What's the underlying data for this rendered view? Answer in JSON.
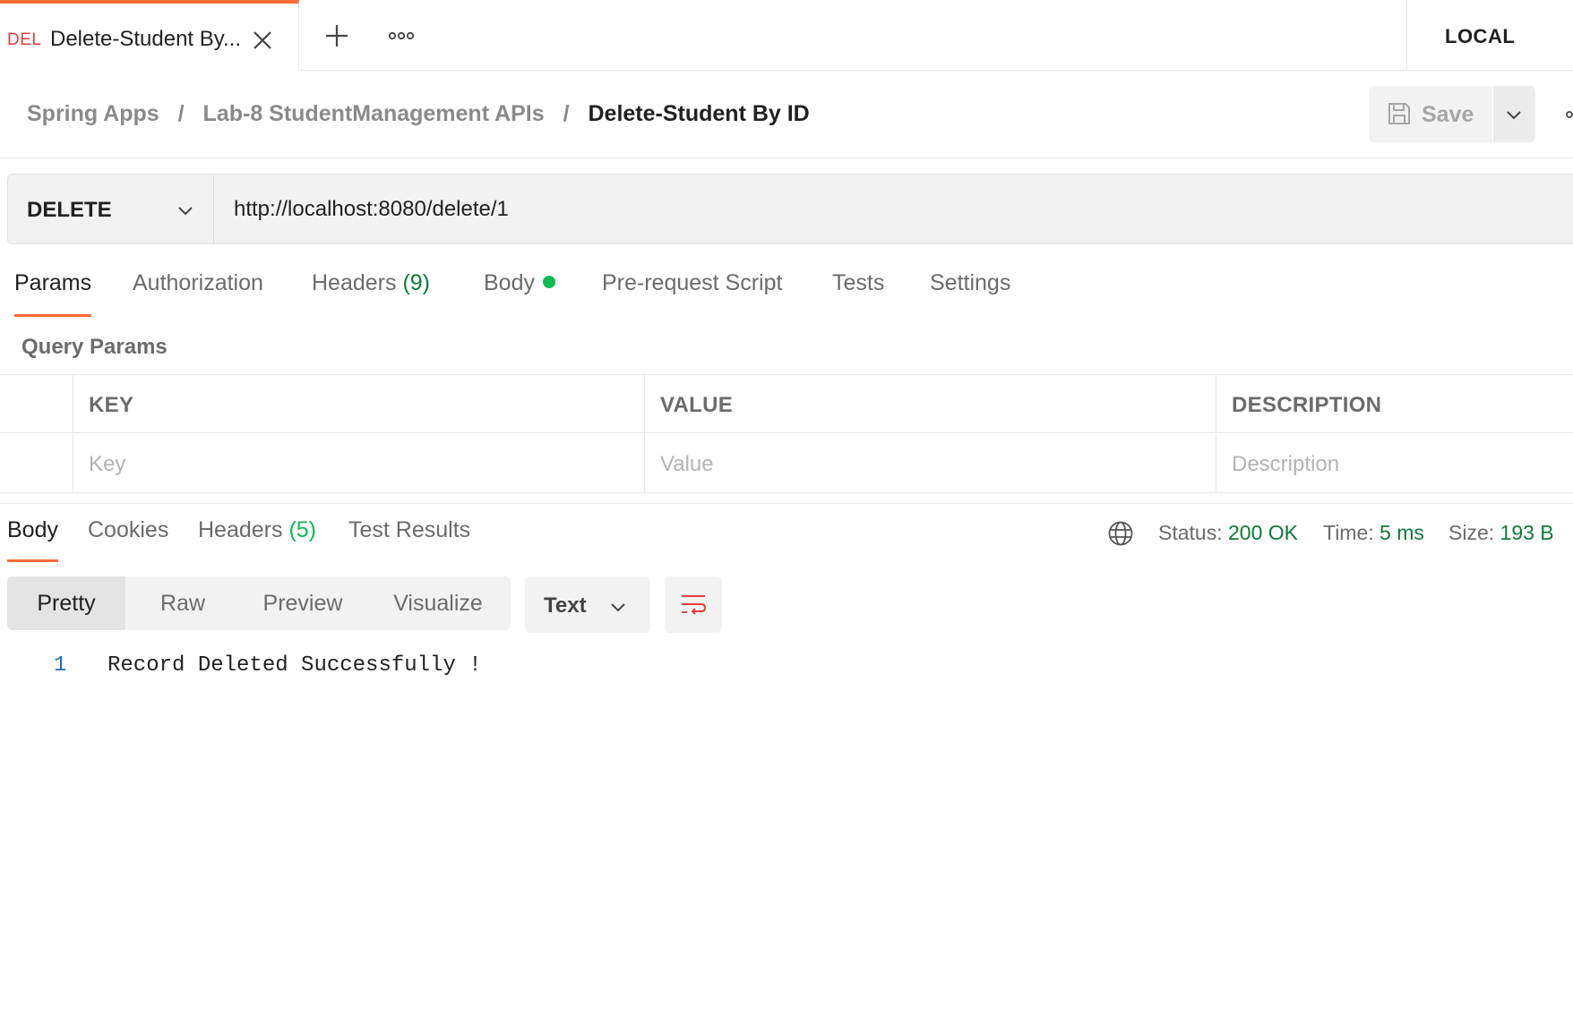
{
  "tabs": {
    "active": {
      "method": "DEL",
      "title": "Delete-Student By..."
    },
    "environment": "LOCAL"
  },
  "breadcrumb": {
    "items": [
      "Spring Apps",
      "Lab-8 StudentManagement APIs"
    ],
    "separator": "/",
    "current": "Delete-Student By ID"
  },
  "toolbar": {
    "save_label": "Save"
  },
  "request": {
    "method": "DELETE",
    "url": "http://localhost:8080/delete/1"
  },
  "request_tabs": {
    "params": "Params",
    "authorization": "Authorization",
    "headers": "Headers",
    "headers_count": "(9)",
    "body": "Body",
    "prerequest": "Pre-request Script",
    "tests": "Tests",
    "settings": "Settings",
    "active": "Params"
  },
  "query_params": {
    "label": "Query Params",
    "columns": {
      "key": "KEY",
      "value": "VALUE",
      "description": "DESCRIPTION"
    },
    "placeholders": {
      "key": "Key",
      "value": "Value",
      "description": "Description"
    }
  },
  "response_tabs": {
    "body": "Body",
    "cookies": "Cookies",
    "headers": "Headers",
    "headers_count": "(5)",
    "test_results": "Test Results",
    "active": "Body"
  },
  "response_meta": {
    "status_label": "Status:",
    "status_value": "200 OK",
    "time_label": "Time:",
    "time_value": "5 ms",
    "size_label": "Size:",
    "size_value": "193 B"
  },
  "response_view": {
    "modes": [
      "Pretty",
      "Raw",
      "Preview",
      "Visualize"
    ],
    "active_mode": "Pretty",
    "format": "Text"
  },
  "response_body": {
    "lines": [
      {
        "number": "1",
        "text": "Record Deleted Successfully !"
      }
    ]
  },
  "colors": {
    "accent": "#ff6c37",
    "method_delete": "#e5403b",
    "status_ok": "#0f7b3a",
    "body_dot": "#0cbb52"
  },
  "icons": [
    "close-icon",
    "plus-icon",
    "more-icon",
    "save-icon",
    "chevron-down-icon",
    "globe-icon",
    "wrap-lines-icon"
  ]
}
